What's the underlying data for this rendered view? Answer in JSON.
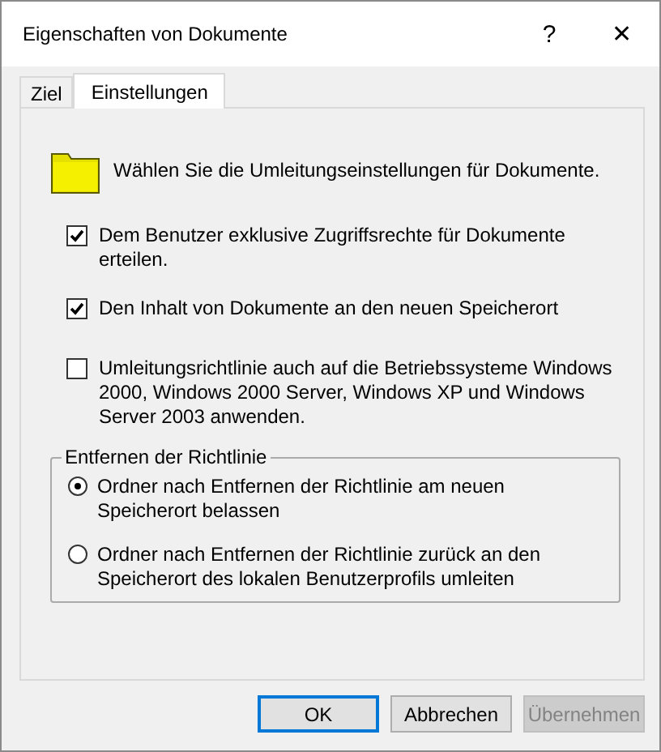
{
  "window": {
    "title": "Eigenschaften von Dokumente",
    "help": "?",
    "close": "✕"
  },
  "tabs": [
    {
      "label": "Ziel",
      "selected": false
    },
    {
      "label": "Einstellungen",
      "selected": true
    }
  ],
  "intro": "Wählen Sie die Umleitungseinstellungen für Dokumente.",
  "options": [
    {
      "label": "Dem Benutzer exklusive Zugriffsrechte für Dokumente erteilen.",
      "checked": true
    },
    {
      "label": "Den Inhalt von Dokumente an den neuen Speicherort",
      "checked": true
    },
    {
      "label": "Umleitungsrichtlinie auch auf die Betriebssysteme Windows 2000, Windows 2000 Server, Windows XP und Windows Server 2003 anwenden.",
      "checked": false
    }
  ],
  "policy_removal": {
    "title": "Entfernen der Richtlinie",
    "choices": [
      {
        "label": "Ordner nach Entfernen der Richtlinie am neuen Speicherort belassen",
        "selected": true
      },
      {
        "label": "Ordner nach Entfernen der Richtlinie zurück an den Speicherort des lokalen Benutzerprofils umleiten",
        "selected": false
      }
    ]
  },
  "buttons": [
    {
      "label": "OK",
      "default": true,
      "disabled": false
    },
    {
      "label": "Abbrechen",
      "default": false,
      "disabled": false
    },
    {
      "label": "Übernehmen",
      "default": false,
      "disabled": true
    }
  ]
}
